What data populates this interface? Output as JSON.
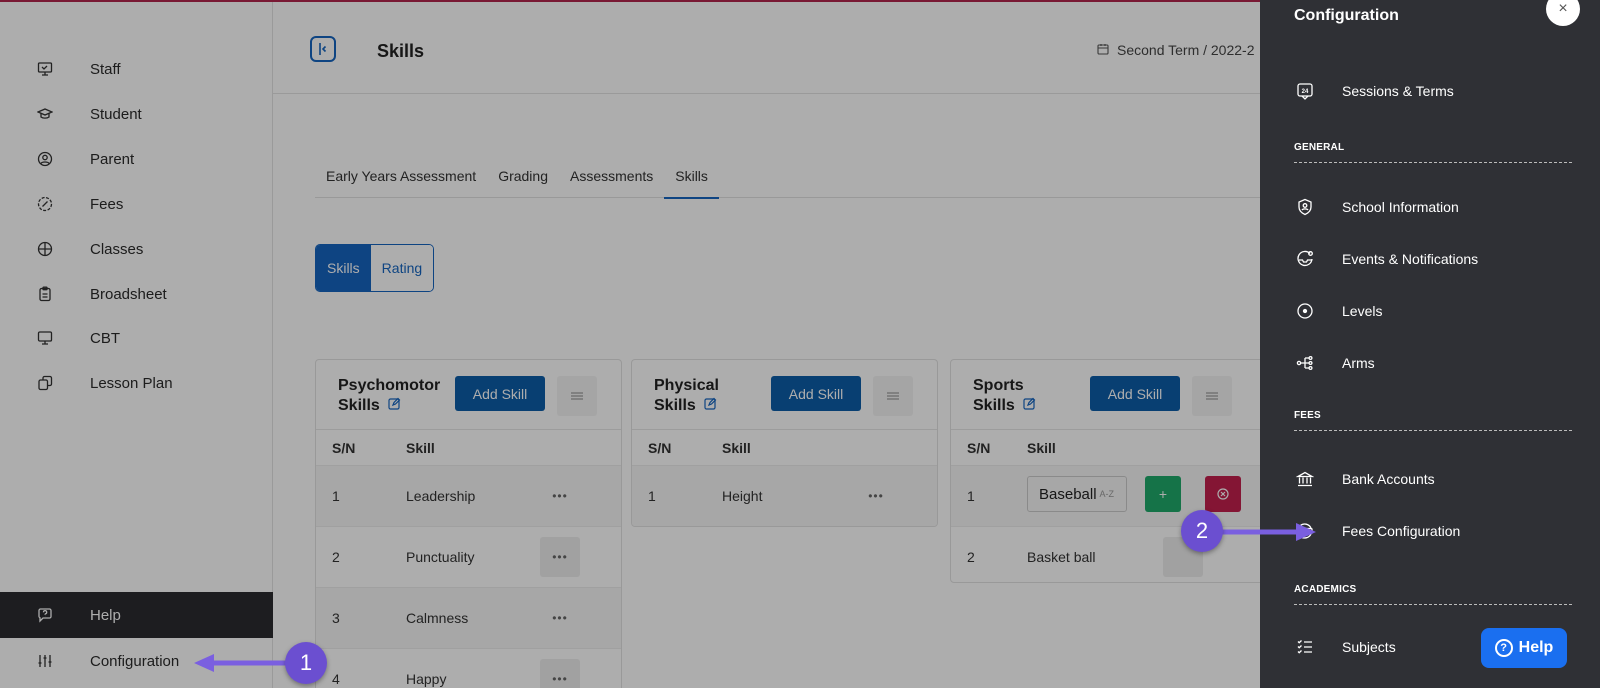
{
  "sidebar": {
    "items": [
      {
        "label": "Staff",
        "icon": "easel-icon"
      },
      {
        "label": "Student",
        "icon": "graduation-cap-icon"
      },
      {
        "label": "Parent",
        "icon": "user-circle-icon"
      },
      {
        "label": "Fees",
        "icon": "fees-icon"
      },
      {
        "label": "Classes",
        "icon": "grid-icon"
      },
      {
        "label": "Broadsheet",
        "icon": "clipboard-icon"
      },
      {
        "label": "CBT",
        "icon": "monitor-icon"
      },
      {
        "label": "Lesson Plan",
        "icon": "copy-icon"
      }
    ],
    "help_label": "Help",
    "config_label": "Configuration"
  },
  "header": {
    "title": "Skills",
    "term": "Second Term / 2022-2"
  },
  "tabs": [
    {
      "label": "Early Years Assessment"
    },
    {
      "label": "Grading"
    },
    {
      "label": "Assessments"
    },
    {
      "label": "Skills"
    }
  ],
  "toggle": {
    "skills": "Skills",
    "rating": "Rating"
  },
  "cards": [
    {
      "title_line1": "Psychomotor",
      "title_line2": "Skills",
      "add_label": "Add Skill",
      "col_sn": "S/N",
      "col_skill": "Skill",
      "rows": [
        {
          "sn": "1",
          "skill": "Leadership"
        },
        {
          "sn": "2",
          "skill": "Punctuality"
        },
        {
          "sn": "3",
          "skill": "Calmness"
        },
        {
          "sn": "4",
          "skill": "Happy"
        }
      ]
    },
    {
      "title_line1": "Physical",
      "title_line2": "Skills",
      "add_label": "Add Skill",
      "col_sn": "S/N",
      "col_skill": "Skill",
      "rows": [
        {
          "sn": "1",
          "skill": "Height"
        }
      ]
    },
    {
      "title_line1": "Sports",
      "title_line2": "Skills",
      "add_label": "Add Skill",
      "col_sn": "S/N",
      "col_skill": "Skill",
      "edit_value": "Baseball",
      "sort_hint": "A-Z",
      "add_small": "+",
      "rows": [
        {
          "sn": "1",
          "skill": "Baseball"
        },
        {
          "sn": "2",
          "skill": "Basket ball"
        }
      ]
    }
  ],
  "drawer": {
    "title": "Configuration",
    "close": "×",
    "sessions": "Sessions & Terms",
    "section_general": "GENERAL",
    "general": [
      "School Information",
      "Events & Notifications",
      "Levels",
      "Arms"
    ],
    "section_fees": "FEES",
    "fees": [
      "Bank Accounts",
      "Fees Configuration"
    ],
    "section_academics": "ACADEMICS",
    "academics": [
      "Subjects"
    ]
  },
  "help_button": {
    "q": "?",
    "label": "Help"
  },
  "callouts": {
    "one": "1",
    "two": "2"
  },
  "colors": {
    "primary": "#1565c0",
    "drawer_bg": "#2f3035",
    "callout": "#6b4fd0",
    "danger": "#c3204d",
    "success": "#1faa6b"
  }
}
